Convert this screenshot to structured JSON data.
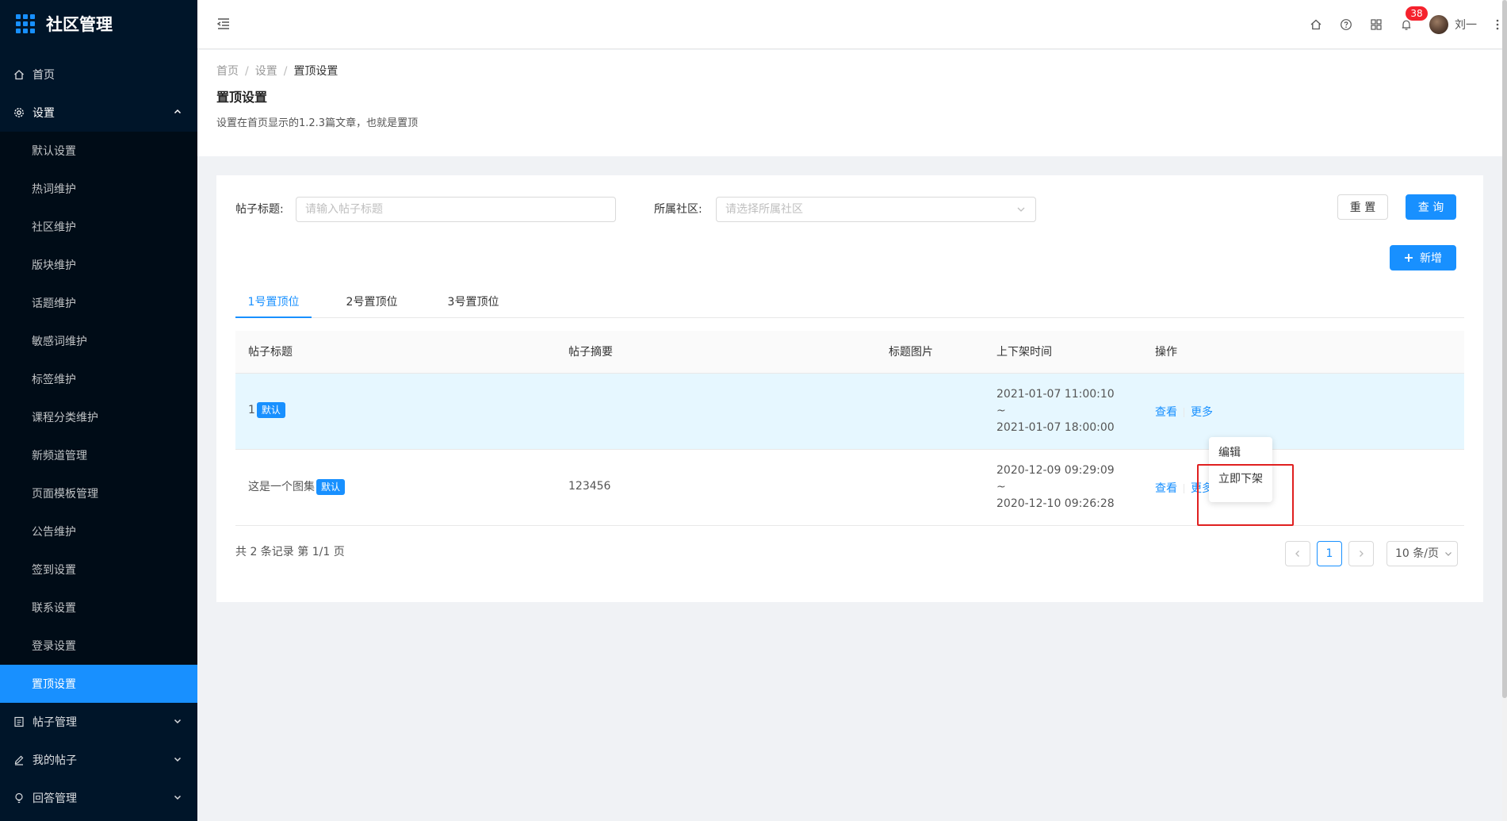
{
  "app": {
    "title": "社区管理"
  },
  "sidebar": {
    "items": [
      {
        "label": "首页",
        "icon": "home-icon"
      },
      {
        "label": "设置",
        "icon": "gear-icon",
        "expanded": true
      }
    ],
    "sub_items": [
      "默认设置",
      "热词维护",
      "社区维护",
      "版块维护",
      "话题维护",
      "敏感词维护",
      "标签维护",
      "课程分类维护",
      "新频道管理",
      "页面模板管理",
      "公告维护",
      "签到设置",
      "联系设置",
      "登录设置",
      "置顶设置"
    ],
    "active_sub": "置顶设置",
    "bottom_items": [
      {
        "label": "帖子管理",
        "icon": "file-icon"
      },
      {
        "label": "我的帖子",
        "icon": "pen-icon"
      },
      {
        "label": "回答管理",
        "icon": "bulb-icon"
      }
    ]
  },
  "header": {
    "notifications_count": "38",
    "user_name": "刘一"
  },
  "page": {
    "breadcrumb": [
      "首页",
      "设置",
      "置顶设置"
    ],
    "title": "置顶设置",
    "description": "设置在首页显示的1.2.3篇文章，也就是置顶"
  },
  "filters": {
    "title_label": "帖子标题:",
    "title_placeholder": "请输入帖子标题",
    "community_label": "所属社区:",
    "community_placeholder": "请选择所属社区",
    "reset_label": "重 置",
    "query_label": "查 询",
    "add_label": "新增"
  },
  "tabs": [
    "1号置顶位",
    "2号置顶位",
    "3号置顶位"
  ],
  "table": {
    "columns": [
      "帖子标题",
      "帖子摘要",
      "标题图片",
      "上下架时间",
      "操作"
    ],
    "rows": [
      {
        "title": "1",
        "tag": "默认",
        "summary": "",
        "start": "2021-01-07 11:00:10",
        "tilde": "~",
        "end": "2021-01-07 18:00:00",
        "view": "查看",
        "more": "更多"
      },
      {
        "title": "这是一个图集",
        "tag": "默认",
        "summary": "123456",
        "start": "2020-12-09 09:29:09",
        "tilde": "~",
        "end": "2020-12-10 09:26:28",
        "view": "查看",
        "more": "更多"
      }
    ]
  },
  "dropdown": {
    "items": [
      "编辑",
      "立即下架"
    ]
  },
  "pagination": {
    "total_text": "共 2 条记录 第 1/1 页",
    "current_page": "1",
    "page_size": "10 条/页"
  },
  "colors": {
    "primary": "#1890ff",
    "sidebar_bg": "#001529",
    "highlight": "#e02020"
  }
}
